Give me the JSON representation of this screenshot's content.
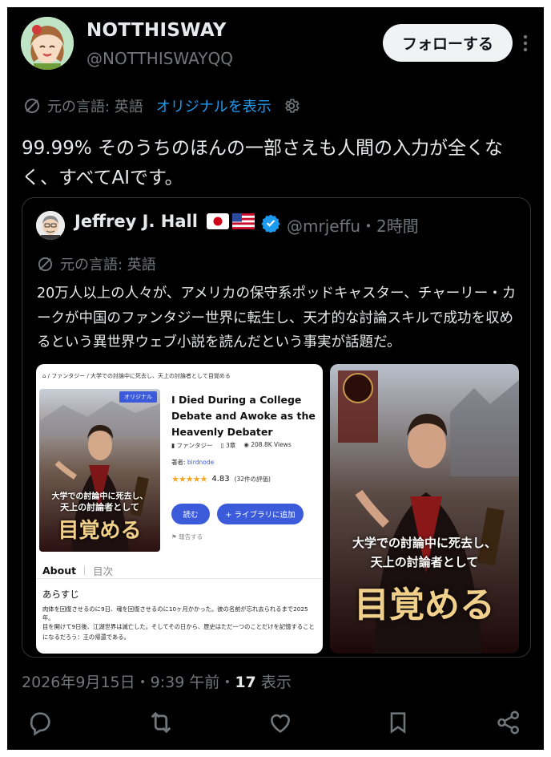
{
  "author": {
    "name": "NOTTHISWAY",
    "handle": "@NOTTHISWAYQQ",
    "follow_label": "フォローする"
  },
  "translation": {
    "original_lang": "元の言語: 英語",
    "show_original": "オリジナルを表示"
  },
  "post_text": "99.99% そのうちのほんの一部さえも人間の入力が全くなく、すべてAIです。",
  "quoted": {
    "name": "Jeffrey J. Hall",
    "flags": "🇯🇵🇺🇸",
    "handle": "@mrjeffu",
    "time": "・2時間",
    "original_lang": "元の言語: 英語",
    "text": "20万人以上の人々が、アメリカの保守系ポッドキャスター、チャーリー・カークが中国のファンタジー世界に転生し、天才的な討論スキルで成功を収めるという異世界ウェブ小説を読んだという事実が話題だ。",
    "page": {
      "breadcrumb": "⌂ / ファンタジー / 大学での討論中に死去し、天上の討論者として目覚める",
      "badge": "オリジナル",
      "book_title": "I Died During a College Debate and Awoke as the Heavenly Debater",
      "genre": "ファンタジー",
      "chapters": "3章",
      "views": "208.8K Views",
      "author_label": "著者: ",
      "author_name": "birdnode",
      "rating": "4.83",
      "rating_count": "(32件の評価)",
      "stars": "★★★★★",
      "read_label": "読む",
      "library_label": "+ ライブラリに追加",
      "report_label": "報告する",
      "tab_about": "About",
      "tab_toc": "目次",
      "synopsis_title": "あらすじ",
      "synopsis_1": "肉体を回復させるのに9日、魂を回復させるのに10ヶ月かかった。彼の名前が忘れ去られるまで2025年。",
      "synopsis_2": "目を開けて9日後、江湖世界は滅亡した。そしてその日から、歴史はただ一つのことだけを記憶することになるだろう：王の帰還である。",
      "cover_line1": "大学での討論中に死去し、",
      "cover_line2": "天上の討論者として",
      "cover_line3": "目覚める"
    },
    "image2": {
      "line1": "大学での討論中に死去し、",
      "line2": "天上の討論者として",
      "line3": "目覚める"
    }
  },
  "timestamp": {
    "date_time": "2026年9月15日・9:39 午前・",
    "views_count": "17",
    "views_label": " 表示"
  },
  "actions": {
    "reply": "reply-icon",
    "repost": "repost-icon",
    "like": "like-icon",
    "bookmark": "bookmark-icon",
    "share": "share-icon"
  },
  "colors": {
    "background": "#000000",
    "accent": "#1d9bf0",
    "muted": "#71767b",
    "book_button": "#3b5bdb"
  }
}
